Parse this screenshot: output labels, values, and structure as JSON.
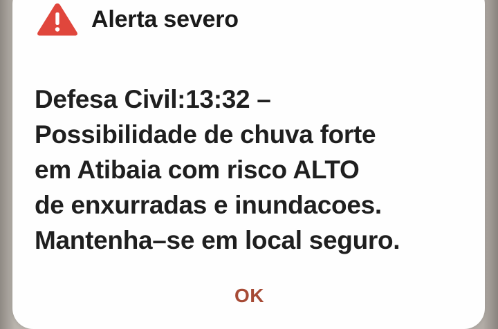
{
  "dialog": {
    "title": "Alerta severo",
    "icon": "warning-triangle-icon",
    "message_lines": [
      "Defesa Civil:13:32 –",
      "Possibilidade de chuva forte",
      "em Atibaia com risco ALTO",
      "de enxurradas e inundacoes.",
      "Mantenha–se em local seguro."
    ],
    "ok_label": "OK"
  },
  "colors": {
    "icon_red": "#e0463c",
    "button_text": "#a64a35",
    "text": "#1f1f1f"
  }
}
